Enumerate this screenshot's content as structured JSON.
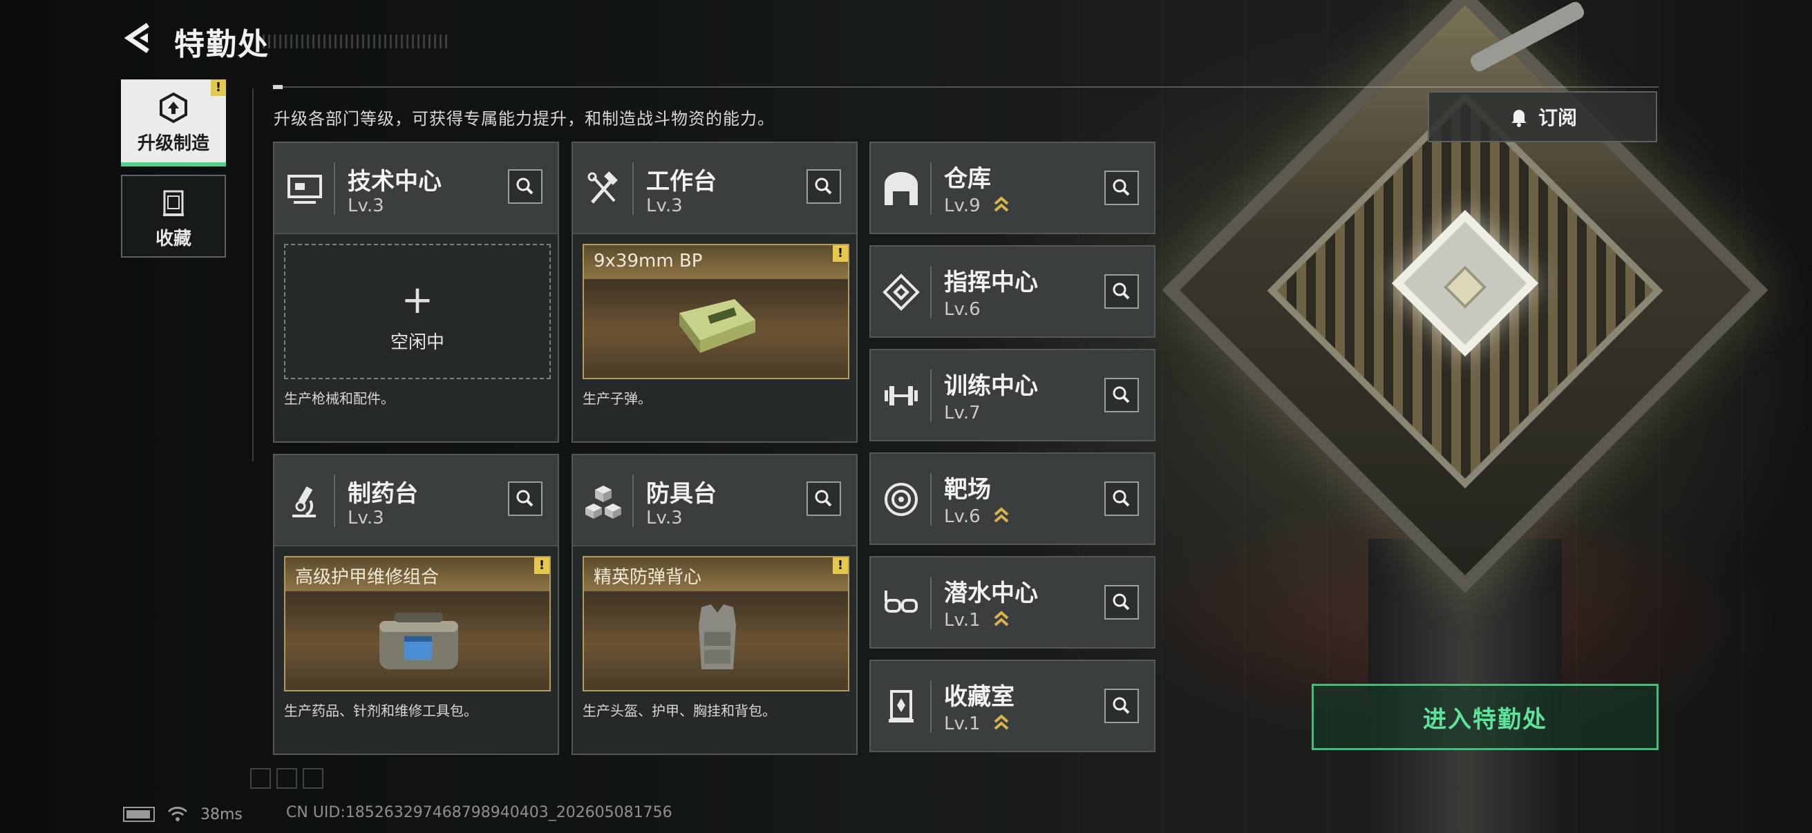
{
  "header": {
    "title": "特勤处"
  },
  "tabs": [
    {
      "label": "升级制造",
      "active": true,
      "badge": "!"
    },
    {
      "label": "收藏",
      "active": false
    }
  ],
  "intro": "升级各部门等级，可获得专属能力提升，和制造战斗物资的能力。",
  "subscribe": {
    "label": "订阅"
  },
  "workshops": [
    {
      "name": "技术中心",
      "level": "Lv.3",
      "slot_type": "empty",
      "idle_label": "空闲中",
      "plus": "+",
      "desc": "生产枪械和配件。"
    },
    {
      "name": "工作台",
      "level": "Lv.3",
      "slot_type": "item",
      "item": "9x39mm BP",
      "badge": "!",
      "desc": "生产子弹。"
    },
    {
      "name": "制药台",
      "level": "Lv.3",
      "slot_type": "item",
      "item": "高级护甲维修组合",
      "badge": "!",
      "desc": "生产药品、针剂和维修工具包。"
    },
    {
      "name": "防具台",
      "level": "Lv.3",
      "slot_type": "item",
      "item": "精英防弹背心",
      "badge": "!",
      "desc": "生产头盔、护甲、胸挂和背包。"
    }
  ],
  "facilities": [
    {
      "name": "仓库",
      "level": "Lv.9",
      "upgradable": true,
      "icon": "warehouse-icon"
    },
    {
      "name": "指挥中心",
      "level": "Lv.6",
      "upgradable": false,
      "icon": "command-center-icon"
    },
    {
      "name": "训练中心",
      "level": "Lv.7",
      "upgradable": false,
      "icon": "dumbbell-icon"
    },
    {
      "name": "靶场",
      "level": "Lv.6",
      "upgradable": true,
      "icon": "target-icon"
    },
    {
      "name": "潜水中心",
      "level": "Lv.1",
      "upgradable": true,
      "icon": "diving-mask-icon"
    },
    {
      "name": "收藏室",
      "level": "Lv.1",
      "upgradable": true,
      "icon": "trophy-case-icon"
    }
  ],
  "enter_button": "进入特勤处",
  "status": {
    "ping": "38ms",
    "uid": "CN UID:185263297468798940403_202605081756"
  },
  "colors": {
    "accent_green": "#3fbf7a",
    "badge_yellow": "#e6c94a",
    "upgrade_gold": "#d8b24a"
  }
}
